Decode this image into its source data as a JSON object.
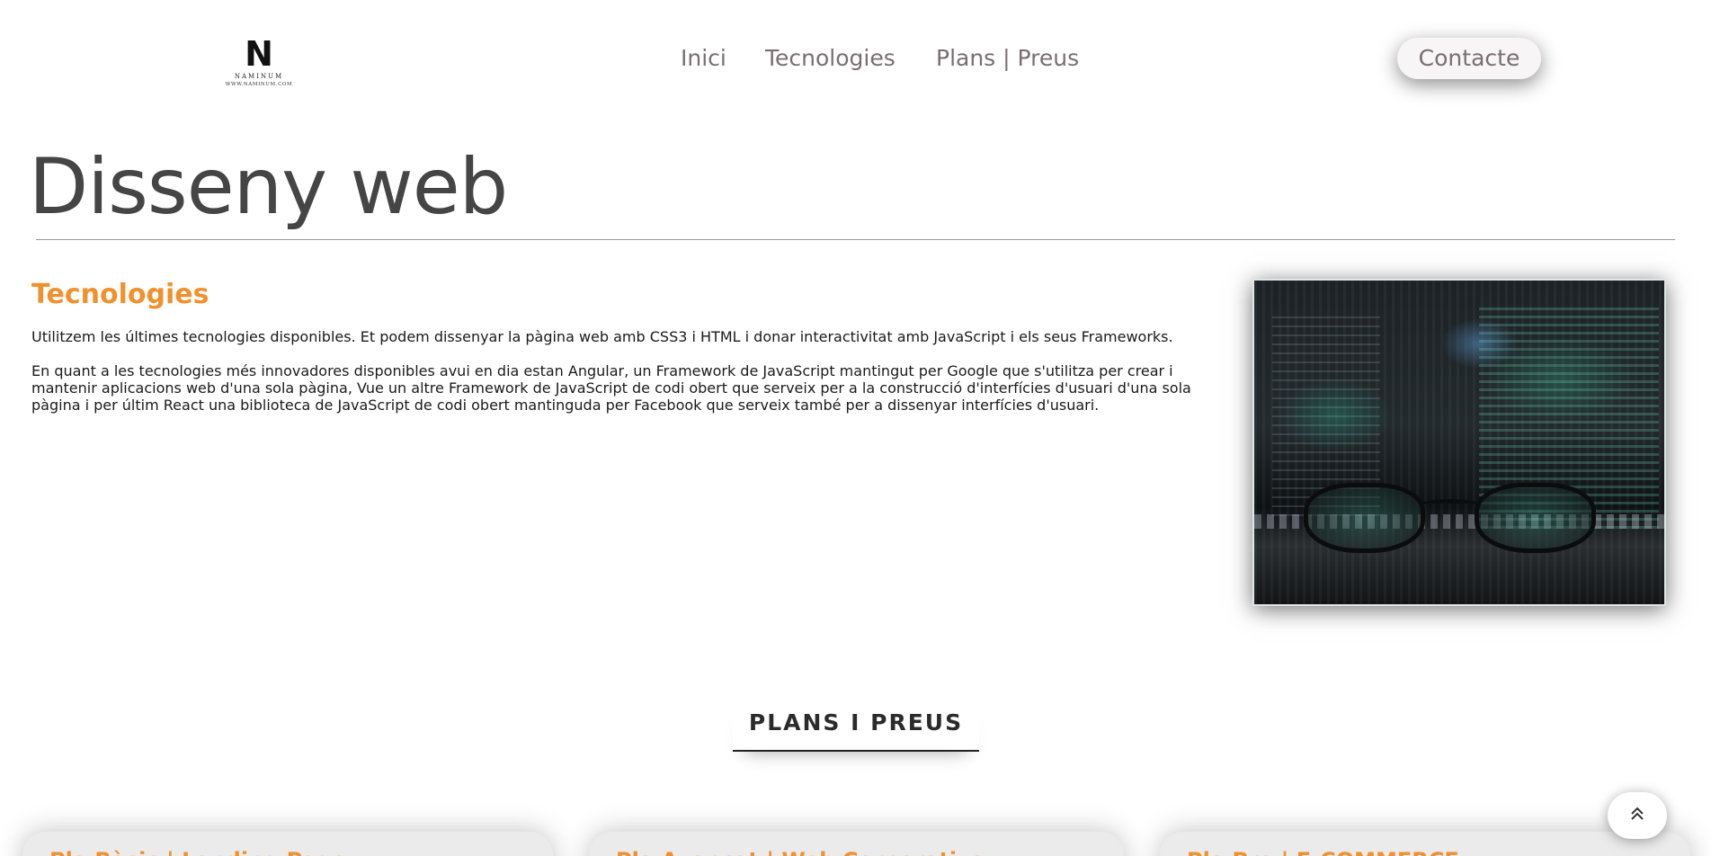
{
  "header": {
    "logo": {
      "letter": "N",
      "name": "NAMINUM",
      "url": "WWW.NAMINUM.COM"
    },
    "nav": [
      {
        "label": "Inici"
      },
      {
        "label": "Tecnologies"
      },
      {
        "label": "Plans | Preus"
      }
    ],
    "contact_label": "Contacte"
  },
  "main": {
    "title": "Disseny web",
    "tecnologies": {
      "heading": "Tecnologies",
      "paragraph_1": "Utilitzem les últimes tecnologies disponibles. Et podem dissenyar la pàgina web amb CSS3 i HTML i donar interactivitat amb JavaScript i els seus Frameworks.",
      "paragraph_2": "En quant a les tecnologies més innovadores disponibles avui en dia estan Angular, un Framework de JavaScript mantingut per Google que s'utilitza per crear i mantenir aplicacions web d'una sola pàgina, Vue un altre Framework de JavaScript de codi obert que serveix per a la construcció d'interfícies d'usuari d'una sola pàgina i per últim React una biblioteca de JavaScript de codi obert mantinguda per Facebook que serveix també per a dissenyar interfícies d'usuari."
    },
    "plans": {
      "heading": "PLANS I PREUS",
      "cards": [
        {
          "title": "Pla Bàsic | Landing Page"
        },
        {
          "title": "Pla Avançat | Web Corporativa"
        },
        {
          "title": "Pla Pro | E-COMMERCE"
        }
      ]
    }
  },
  "icons": {
    "scroll_top": "double-chevron-up-icon"
  },
  "colors": {
    "accent": "#f0912e",
    "nav_text": "#7a6e73",
    "title_text": "#454545"
  }
}
